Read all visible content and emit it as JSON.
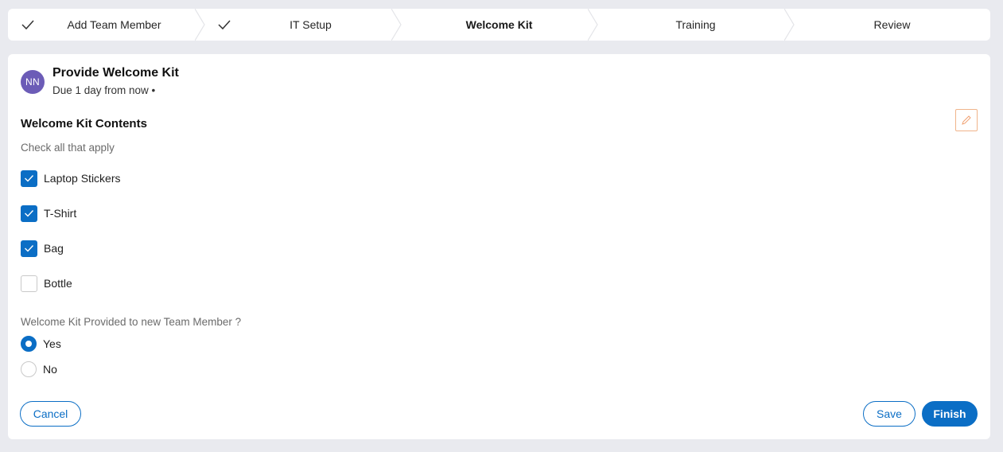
{
  "stepper": {
    "steps": [
      {
        "label": "Add Team Member",
        "status": "done"
      },
      {
        "label": "IT Setup",
        "status": "done"
      },
      {
        "label": "Welcome Kit",
        "status": "current"
      },
      {
        "label": "Training",
        "status": "upcoming"
      },
      {
        "label": "Review",
        "status": "upcoming"
      }
    ]
  },
  "task": {
    "avatar_initials": "NN",
    "title": "Provide Welcome Kit",
    "due": "Due 1 day from now  •"
  },
  "form": {
    "section_title": "Welcome Kit Contents",
    "helper": "Check all that apply",
    "checkboxes": [
      {
        "label": "Laptop Stickers",
        "checked": true
      },
      {
        "label": "T-Shirt",
        "checked": true
      },
      {
        "label": "Bag",
        "checked": true
      },
      {
        "label": "Bottle",
        "checked": false
      }
    ],
    "question": "Welcome Kit Provided to new Team Member ?",
    "radios": [
      {
        "label": "Yes",
        "selected": true
      },
      {
        "label": "No",
        "selected": false
      }
    ]
  },
  "actions": {
    "cancel_label": "Cancel",
    "save_label": "Save",
    "finish_label": "Finish"
  },
  "colors": {
    "accent": "#0b6ec5",
    "avatar": "#6c5cb7",
    "edit_border": "#f0b48a"
  },
  "icons": {
    "step_done": "check-icon",
    "edit": "pencil-icon",
    "checkbox_on": "checkmark-icon"
  }
}
